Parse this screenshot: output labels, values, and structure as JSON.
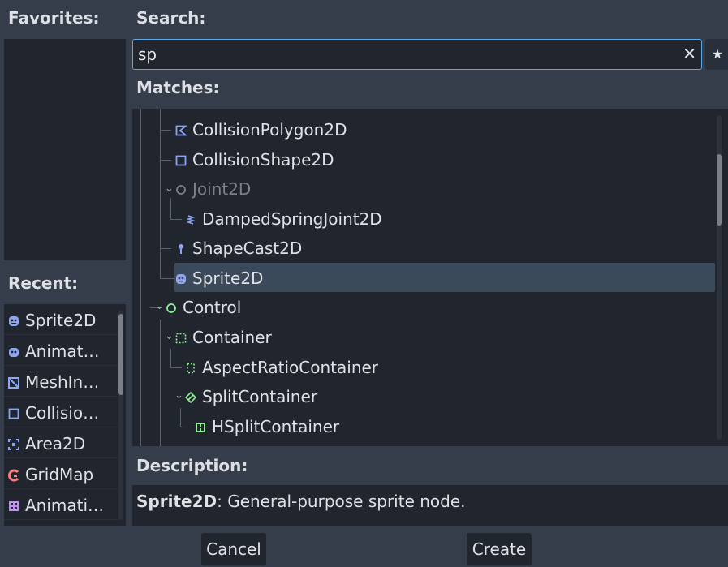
{
  "favorites": {
    "title": "Favorites:"
  },
  "recent": {
    "title": "Recent:",
    "items": [
      {
        "label": "Sprite2D",
        "icon": "sprite2d-icon",
        "color": "#8da5f3"
      },
      {
        "label": "Animat…",
        "icon": "animated-sprite2d-icon",
        "color": "#8da5f3"
      },
      {
        "label": "MeshIn…",
        "icon": "mesh-instance2d-icon",
        "color": "#8da5f3"
      },
      {
        "label": "Collisio…",
        "icon": "collision-shape2d-icon",
        "color": "#8da5f3"
      },
      {
        "label": "Area2D",
        "icon": "area2d-icon",
        "color": "#8da5f3"
      },
      {
        "label": "GridMap",
        "icon": "gridmap-icon",
        "color": "#fc7f7f"
      },
      {
        "label": "Animati…",
        "icon": "animation-tree-icon",
        "color": "#c38ef1"
      }
    ]
  },
  "search": {
    "title": "Search:",
    "value": "sp",
    "clear_glyph": "✕",
    "star_glyph": "★"
  },
  "matches": {
    "title": "Matches:",
    "rows": [
      {
        "label": "CollisionPolygon2D",
        "icon": "collision-polygon2d-icon",
        "color": "#8da5f3",
        "dim": false,
        "selected": false
      },
      {
        "label": "CollisionShape2D",
        "icon": "collision-shape2d-icon",
        "color": "#8da5f3",
        "dim": false,
        "selected": false
      },
      {
        "label": "Joint2D",
        "icon": "joint2d-icon",
        "color": "#7c8089",
        "dim": true,
        "selected": false
      },
      {
        "label": "DampedSpringJoint2D",
        "icon": "damped-spring-joint2d-icon",
        "color": "#8da5f3",
        "dim": false,
        "selected": false
      },
      {
        "label": "ShapeCast2D",
        "icon": "shapecast2d-icon",
        "color": "#8da5f3",
        "dim": false,
        "selected": false
      },
      {
        "label": "Sprite2D",
        "icon": "sprite2d-icon",
        "color": "#8da5f3",
        "dim": false,
        "selected": true
      },
      {
        "label": "Control",
        "icon": "control-icon",
        "color": "#8eef97",
        "dim": false,
        "selected": false
      },
      {
        "label": "Container",
        "icon": "container-icon",
        "color": "#8eef97",
        "dim": false,
        "selected": false
      },
      {
        "label": "AspectRatioContainer",
        "icon": "aspect-ratio-container-icon",
        "color": "#8eef97",
        "dim": false,
        "selected": false
      },
      {
        "label": "SplitContainer",
        "icon": "split-container-icon",
        "color": "#8eef97",
        "dim": false,
        "selected": false
      },
      {
        "label": "HSplitContainer",
        "icon": "hsplit-container-icon",
        "color": "#8eef97",
        "dim": false,
        "selected": false
      }
    ]
  },
  "description": {
    "title": "Description:",
    "node_name": "Sprite2D",
    "text": ": General-purpose sprite node."
  },
  "buttons": {
    "cancel": "Cancel",
    "create": "Create"
  }
}
